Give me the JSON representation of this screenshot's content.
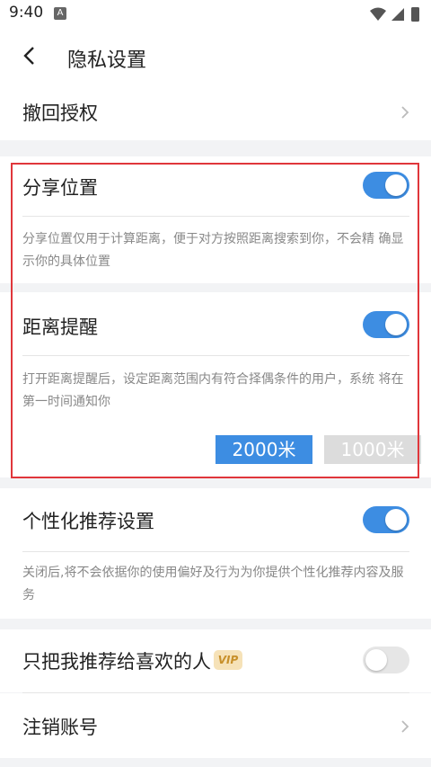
{
  "status_bar": {
    "time": "9:40",
    "notification_icon": "A"
  },
  "header": {
    "title": "隐私设置",
    "back_icon": "chevron-left-icon"
  },
  "revoke": {
    "label": "撤回授权"
  },
  "share_location": {
    "label": "分享位置",
    "enabled": true,
    "description": "分享位置仅用于计算距离，便于对方按照距离搜索到你，不会精 确显示你的具体位置"
  },
  "distance_alert": {
    "label": "距离提醒",
    "enabled": true,
    "description": "打开距离提醒后，设定距离范围内有符合择偶条件的用户，系统 将在第一时间通知你",
    "options": [
      "2000米",
      "1000米"
    ],
    "selected": "2000米"
  },
  "personalized": {
    "label": "个性化推荐设置",
    "enabled": true,
    "description": "关闭后,将不会依据你的使用偏好及行为为你提供个性化推荐内容及服务"
  },
  "recommend_liked": {
    "label": "只把我推荐给喜欢的人",
    "badge": "VIP",
    "enabled": false
  },
  "cancel_account": {
    "label": "注销账号"
  },
  "colors": {
    "accent": "#3d8de2",
    "highlight_border": "#e0363b",
    "toggle_off": "#e6e6e6",
    "vip": "#c8902a"
  }
}
